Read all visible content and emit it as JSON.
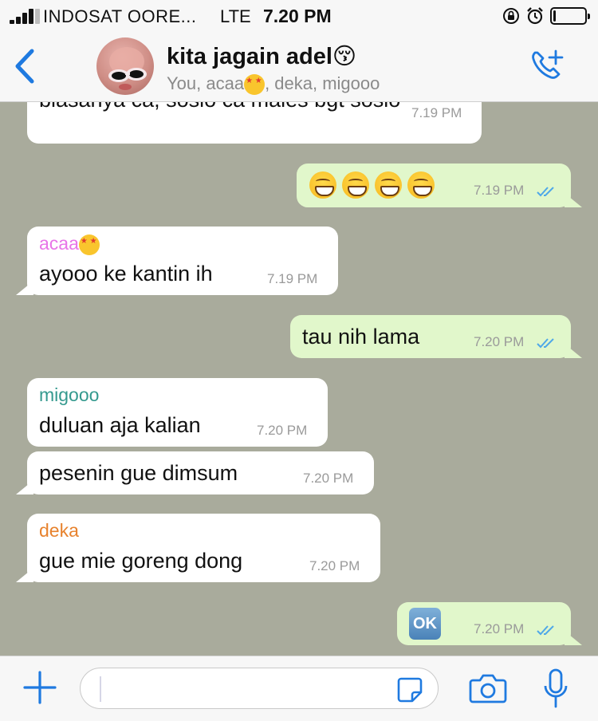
{
  "status_bar": {
    "carrier": "INDOSAT OORE...",
    "network": "LTE",
    "time": "7.20 PM",
    "icons": [
      "signal-icon",
      "orientation-lock-icon",
      "alarm-icon",
      "battery-icon"
    ],
    "battery_level": 0.08
  },
  "header": {
    "back_icon": "chevron-left-icon",
    "title": "kita jagain adel",
    "title_emoji": "😚",
    "subtitle_you": "You, acaa",
    "subtitle_rest": ", deka, migooo",
    "call_icon": "add-call-icon"
  },
  "colors": {
    "accent": "#1f7ae0",
    "chat_bg": "#a9ab9c",
    "incoming_bubble": "#ffffff",
    "outgoing_bubble": "#e1f7cb",
    "acaa": "#e875e8",
    "migooo": "#34998e",
    "deka": "#e7822d",
    "read_ticks": "#4fa8e8"
  },
  "messages": [
    {
      "direction": "in",
      "sender": "",
      "text": "biasanya ca, sosio ca males bgt sosio",
      "time": "7.19 PM"
    },
    {
      "direction": "out",
      "text": "😁😁😁😁",
      "time": "7.19 PM",
      "status": "read"
    },
    {
      "direction": "in",
      "sender": "acaa",
      "text": "ayooo ke kantin ih",
      "time": "7.19 PM"
    },
    {
      "direction": "out",
      "text": "tau nih lama",
      "time": "7.20 PM",
      "status": "read"
    },
    {
      "direction": "in",
      "sender": "migooo",
      "text": "duluan aja kalian",
      "time": "7.20 PM"
    },
    {
      "direction": "in",
      "sender": "",
      "text": "pesenin gue dimsum",
      "time": "7.20 PM"
    },
    {
      "direction": "in",
      "sender": "deka",
      "text": "gue mie goreng dong",
      "time": "7.20 PM"
    },
    {
      "direction": "out",
      "text": "🆗",
      "time": "7.20 PM",
      "status": "read"
    }
  ],
  "ok_label": "OK",
  "input_bar": {
    "placeholder": "",
    "icons": [
      "plus-icon",
      "sticker-icon",
      "camera-icon",
      "microphone-icon"
    ]
  }
}
